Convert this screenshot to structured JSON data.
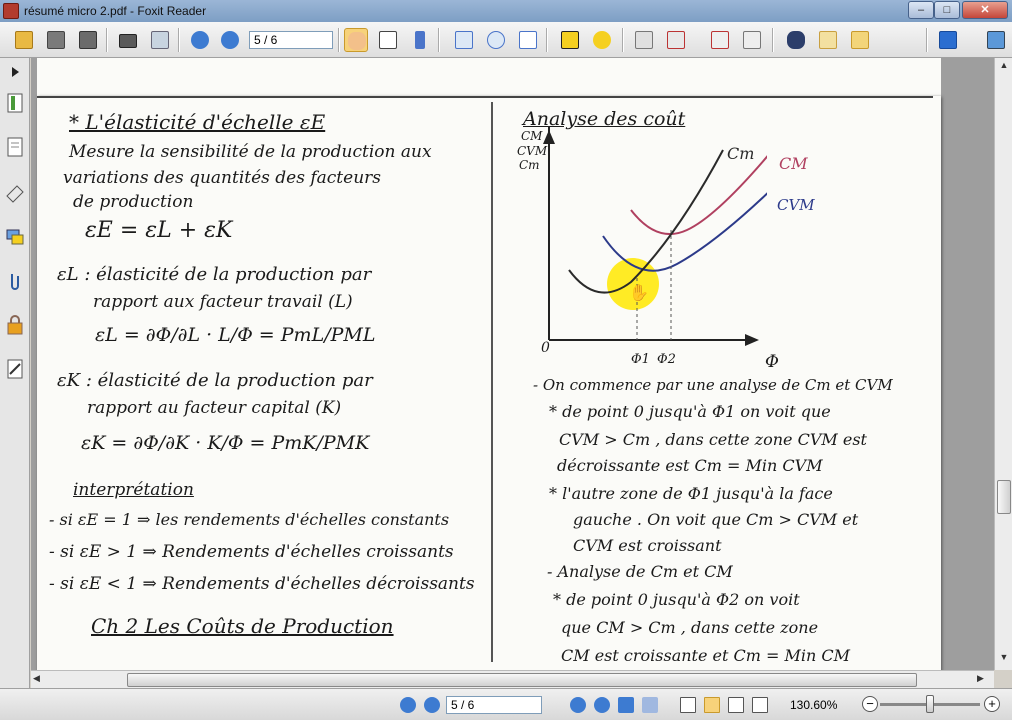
{
  "window": {
    "title": "résumé micro 2.pdf - Foxit Reader",
    "minimize_glyph": "–",
    "maximize_glyph": "□",
    "close_glyph": "✕"
  },
  "toolbar": {
    "page_value": "5 / 6",
    "icons": [
      "open-folder-icon",
      "save-icon",
      "save-all-icon",
      "print-icon",
      "scan-icon",
      "prev-page-icon",
      "next-page-icon",
      "hand-tool-icon",
      "select-text-icon",
      "select-icon",
      "snapshot-icon",
      "rotate-icon",
      "fit-page-icon",
      "typewriter-icon",
      "comment-icon",
      "create-pdf-icon",
      "pdf-dropdown-icon",
      "pdf-form-icon",
      "pdf-convert-icon",
      "find-icon",
      "bookmark-icon",
      "stamp-icon",
      "foxit-logo-icon",
      "screen-icon"
    ]
  },
  "document": {
    "left_column": [
      "* L'élasticité d'échelle  εE",
      "Mesure la sensibilité de la production aux",
      "variations des quantités des facteurs",
      "de production",
      "εE = εL + εK",
      "εL : élasticité de la production par",
      "rapport aux facteur travail (L)",
      "εL = ∂Φ/∂L · L/Φ = PmL/PML",
      "εK : élasticité de la production par",
      "rapport au facteur capital (K)",
      "εK = ∂Φ/∂K · K/Φ = PmK/PMK",
      "interprétation",
      "- si εE = 1 ⇒ les rendements d'échelles constants",
      "- si εE > 1 ⇒ Rendements d'échelles croissants",
      "- si εE < 1 ⇒ Rendements d'échelles décroissants",
      "Ch 2      Les Coûts de Production"
    ],
    "right_column": {
      "heading": "Analyse des coût",
      "chart_y_labels": [
        "CM",
        "CVM",
        "Cm"
      ],
      "curve_cm": "Cm",
      "curve_CM": "CM",
      "curve_CVM": "CVM",
      "origin": "0",
      "x_axis": "Φ",
      "x_ticks": [
        "Φ1",
        "Φ2"
      ],
      "notes": [
        "- On commence par une analyse de Cm et CVM",
        "* de point 0 jusqu'à Φ1 on voit que",
        "CVM > Cm , dans cette zone CVM est",
        "décroissante est Cm = Min CVM",
        "* l'autre zone de Φ1 jusqu'à la face",
        "gauche . On voit que Cm > CVM et",
        "CVM est croissant",
        "- Analyse de Cm et CM",
        "* de point 0 jusqu'à Φ2 on voit",
        "que CM > Cm , dans cette zone",
        "CM est croissante et Cm = Min CM"
      ]
    },
    "colors": {
      "ink": "#1a1a1a",
      "cm_curve": "#2a2a2a",
      "CM_curve": "#b04060",
      "CVM_curve": "#2c3a8a",
      "cursor_highlight": "#ffe800"
    }
  },
  "statusbar": {
    "page_value": "5 / 6",
    "zoom": "130.60%",
    "zoom_out_glyph": "−",
    "zoom_in_glyph": "+"
  }
}
